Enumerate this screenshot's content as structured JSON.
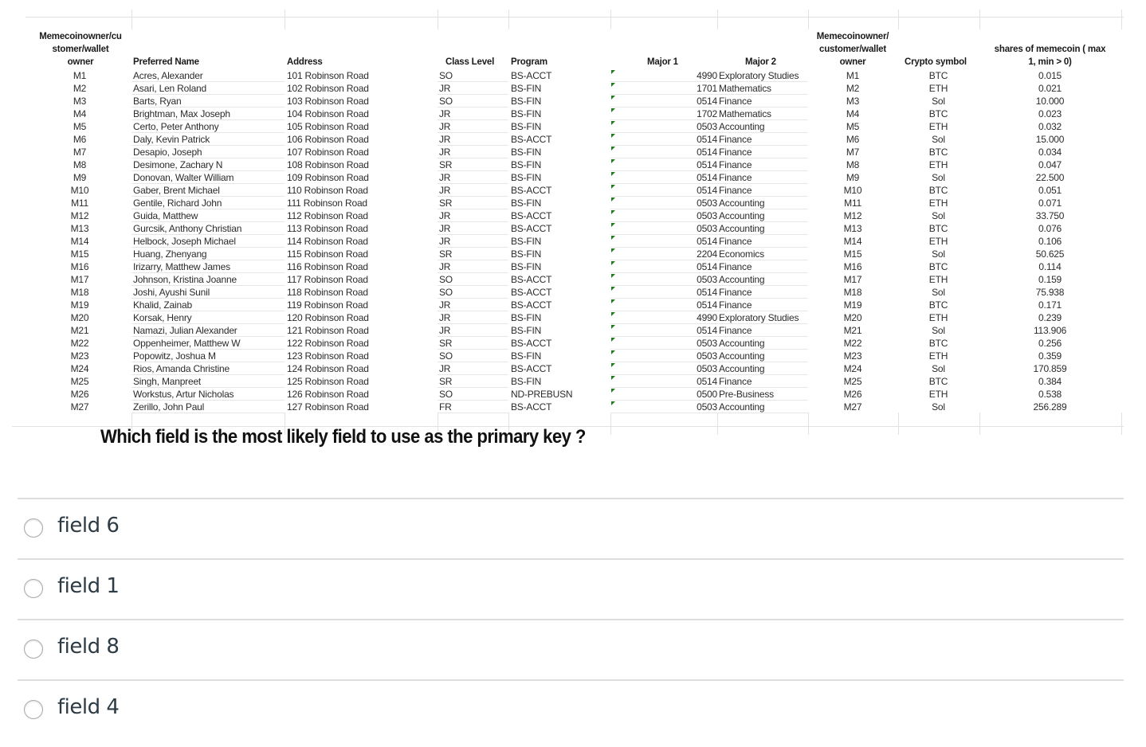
{
  "spreadsheet": {
    "headers": {
      "owner_id": "Memecoinowner/cu stomer/wallet owner",
      "owner_id_lines": [
        "Memecoinowner/cu",
        "stomer/wallet",
        "owner"
      ],
      "preferred_name": "Preferred Name",
      "address": "Address",
      "class_level": "Class Level",
      "program": "Program",
      "major1": "Major 1",
      "major2": "Major 2",
      "owner_id2_lines": [
        "Memecoinowner/",
        "customer/wallet",
        "owner"
      ],
      "crypto_symbol": "Crypto symbol",
      "shares_lines": [
        "shares of memecoin ( max",
        "1, min > 0)"
      ]
    },
    "rows": [
      {
        "id": "M1",
        "name": "Acres, Alexander",
        "address": "101 Robinson Road",
        "class": "SO",
        "program": "BS-ACCT",
        "major_code": "4990",
        "major_name": "Exploratory Studies",
        "owner": "M1",
        "symbol": "BTC",
        "shares": "0.015"
      },
      {
        "id": "M2",
        "name": "Asari, Len Roland",
        "address": "102 Robinson Road",
        "class": "JR",
        "program": "BS-FIN",
        "major_code": "1701",
        "major_name": "Mathematics",
        "owner": "M2",
        "symbol": "ETH",
        "shares": "0.021"
      },
      {
        "id": "M3",
        "name": "Barts, Ryan",
        "address": "103 Robinson Road",
        "class": "SO",
        "program": "BS-FIN",
        "major_code": "0514",
        "major_name": "Finance",
        "owner": "M3",
        "symbol": "Sol",
        "shares": "10.000"
      },
      {
        "id": "M4",
        "name": "Brightman, Max Joseph",
        "address": "104 Robinson Road",
        "class": "JR",
        "program": "BS-FIN",
        "major_code": "1702",
        "major_name": "Mathematics",
        "owner": "M4",
        "symbol": "BTC",
        "shares": "0.023"
      },
      {
        "id": "M5",
        "name": "Certo, Peter Anthony",
        "address": "105 Robinson Road",
        "class": "JR",
        "program": "BS-FIN",
        "major_code": "0503",
        "major_name": "Accounting",
        "owner": "M5",
        "symbol": "ETH",
        "shares": "0.032"
      },
      {
        "id": "M6",
        "name": "Daly, Kevin Patrick",
        "address": "106 Robinson Road",
        "class": "JR",
        "program": "BS-ACCT",
        "major_code": "0514",
        "major_name": "Finance",
        "owner": "M6",
        "symbol": "Sol",
        "shares": "15.000"
      },
      {
        "id": "M7",
        "name": "Desapio, Joseph",
        "address": "107 Robinson Road",
        "class": "JR",
        "program": "BS-FIN",
        "major_code": "0514",
        "major_name": "Finance",
        "owner": "M7",
        "symbol": "BTC",
        "shares": "0.034"
      },
      {
        "id": "M8",
        "name": "Desimone, Zachary N",
        "address": "108 Robinson Road",
        "class": "SR",
        "program": "BS-FIN",
        "major_code": "0514",
        "major_name": "Finance",
        "owner": "M8",
        "symbol": "ETH",
        "shares": "0.047"
      },
      {
        "id": "M9",
        "name": "Donovan, Walter William",
        "address": "109 Robinson Road",
        "class": "JR",
        "program": "BS-FIN",
        "major_code": "0514",
        "major_name": "Finance",
        "owner": "M9",
        "symbol": "Sol",
        "shares": "22.500"
      },
      {
        "id": "M10",
        "name": "Gaber, Brent Michael",
        "address": "110 Robinson Road",
        "class": "JR",
        "program": "BS-ACCT",
        "major_code": "0514",
        "major_name": "Finance",
        "owner": "M10",
        "symbol": "BTC",
        "shares": "0.051"
      },
      {
        "id": "M11",
        "name": "Gentile, Richard John",
        "address": "111 Robinson Road",
        "class": "SR",
        "program": "BS-FIN",
        "major_code": "0503",
        "major_name": "Accounting",
        "owner": "M11",
        "symbol": "ETH",
        "shares": "0.071"
      },
      {
        "id": "M12",
        "name": "Guida, Matthew",
        "address": "112 Robinson Road",
        "class": "JR",
        "program": "BS-ACCT",
        "major_code": "0503",
        "major_name": "Accounting",
        "owner": "M12",
        "symbol": "Sol",
        "shares": "33.750"
      },
      {
        "id": "M13",
        "name": "Gurcsik, Anthony Christian",
        "address": "113 Robinson Road",
        "class": "JR",
        "program": "BS-ACCT",
        "major_code": "0503",
        "major_name": "Accounting",
        "owner": "M13",
        "symbol": "BTC",
        "shares": "0.076"
      },
      {
        "id": "M14",
        "name": "Helbock, Joseph Michael",
        "address": "114 Robinson Road",
        "class": "JR",
        "program": "BS-FIN",
        "major_code": "0514",
        "major_name": "Finance",
        "owner": "M14",
        "symbol": "ETH",
        "shares": "0.106"
      },
      {
        "id": "M15",
        "name": "Huang, Zhenyang",
        "address": "115 Robinson Road",
        "class": "SR",
        "program": "BS-FIN",
        "major_code": "2204",
        "major_name": "Economics",
        "owner": "M15",
        "symbol": "Sol",
        "shares": "50.625"
      },
      {
        "id": "M16",
        "name": "Irizarry, Matthew James",
        "address": "116 Robinson Road",
        "class": "JR",
        "program": "BS-FIN",
        "major_code": "0514",
        "major_name": "Finance",
        "owner": "M16",
        "symbol": "BTC",
        "shares": "0.114"
      },
      {
        "id": "M17",
        "name": "Johnson, Kristina Joanne",
        "address": "117 Robinson Road",
        "class": "SO",
        "program": "BS-ACCT",
        "major_code": "0503",
        "major_name": "Accounting",
        "owner": "M17",
        "symbol": "ETH",
        "shares": "0.159"
      },
      {
        "id": "M18",
        "name": "Joshi, Ayushi Sunil",
        "address": "118 Robinson Road",
        "class": "SO",
        "program": "BS-ACCT",
        "major_code": "0514",
        "major_name": "Finance",
        "owner": "M18",
        "symbol": "Sol",
        "shares": "75.938"
      },
      {
        "id": "M19",
        "name": "Khalid, Zainab",
        "address": "119 Robinson Road",
        "class": "JR",
        "program": "BS-ACCT",
        "major_code": "0514",
        "major_name": "Finance",
        "owner": "M19",
        "symbol": "BTC",
        "shares": "0.171"
      },
      {
        "id": "M20",
        "name": "Korsak, Henry",
        "address": "120 Robinson Road",
        "class": "JR",
        "program": "BS-FIN",
        "major_code": "4990",
        "major_name": "Exploratory Studies",
        "owner": "M20",
        "symbol": "ETH",
        "shares": "0.239"
      },
      {
        "id": "M21",
        "name": "Namazi, Julian Alexander",
        "address": "121 Robinson Road",
        "class": "JR",
        "program": "BS-FIN",
        "major_code": "0514",
        "major_name": "Finance",
        "owner": "M21",
        "symbol": "Sol",
        "shares": "113.906"
      },
      {
        "id": "M22",
        "name": "Oppenheimer, Matthew W",
        "address": "122 Robinson Road",
        "class": "SR",
        "program": "BS-ACCT",
        "major_code": "0503",
        "major_name": "Accounting",
        "owner": "M22",
        "symbol": "BTC",
        "shares": "0.256"
      },
      {
        "id": "M23",
        "name": "Popowitz, Joshua M",
        "address": "123 Robinson Road",
        "class": "SO",
        "program": "BS-FIN",
        "major_code": "0503",
        "major_name": "Accounting",
        "owner": "M23",
        "symbol": "ETH",
        "shares": "0.359"
      },
      {
        "id": "M24",
        "name": "Rios, Amanda Christine",
        "address": "124 Robinson Road",
        "class": "JR",
        "program": "BS-ACCT",
        "major_code": "0503",
        "major_name": "Accounting",
        "owner": "M24",
        "symbol": "Sol",
        "shares": "170.859"
      },
      {
        "id": "M25",
        "name": "Singh, Manpreet",
        "address": "125 Robinson Road",
        "class": "SR",
        "program": "BS-FIN",
        "major_code": "0514",
        "major_name": "Finance",
        "owner": "M25",
        "symbol": "BTC",
        "shares": "0.384"
      },
      {
        "id": "M26",
        "name": "Workstus, Artur Nicholas",
        "address": "126 Robinson Road",
        "class": "SO",
        "program": "ND-PREBUSN",
        "major_code": "0500",
        "major_name": "Pre-Business",
        "owner": "M26",
        "symbol": "ETH",
        "shares": "0.538"
      },
      {
        "id": "M27",
        "name": "Zerillo, John Paul",
        "address": "127 Robinson Road",
        "class": "FR",
        "program": "BS-ACCT",
        "major_code": "0503",
        "major_name": "Accounting",
        "owner": "M27",
        "symbol": "Sol",
        "shares": "256.289"
      }
    ]
  },
  "question": {
    "text": "Which field is the most likely field to use as the primary key ?"
  },
  "answers": [
    {
      "label": "field 6",
      "selected": false
    },
    {
      "label": "field 1",
      "selected": false
    },
    {
      "label": "field 8",
      "selected": false
    },
    {
      "label": "field 4",
      "selected": false
    }
  ],
  "colors": {
    "error_flag": "#1e7a1e",
    "divider": "#dddddd",
    "answer_text": "#2d3b45"
  }
}
